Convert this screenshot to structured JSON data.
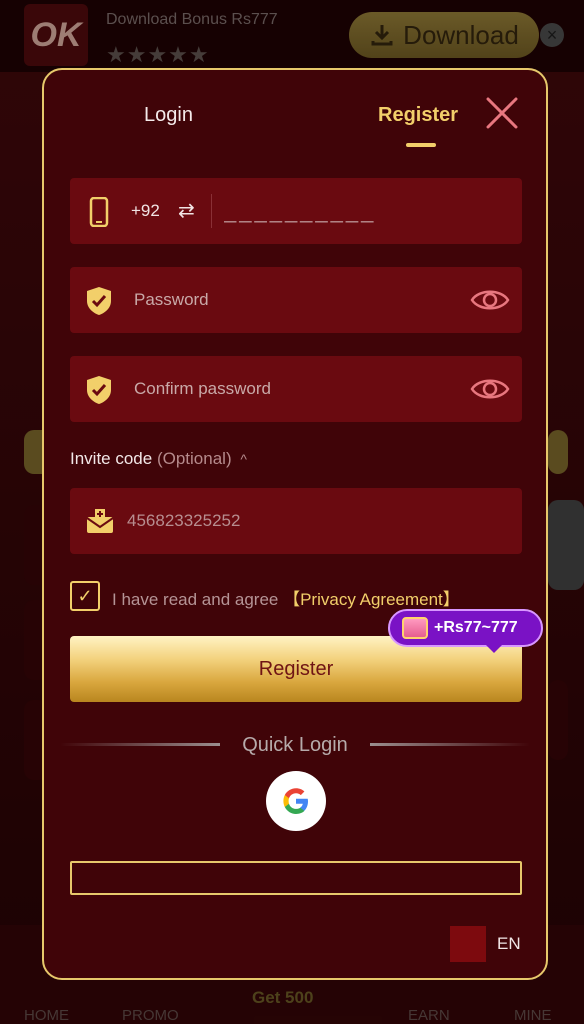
{
  "background": {
    "banner": {
      "logo_text": "OK",
      "title": "Download Bonus Rs777",
      "stars": "★★★★★",
      "download_label": "Download",
      "close_glyph": "×"
    },
    "nav": {
      "home": "HOME",
      "promo": "PROMO",
      "get": "Get 500",
      "earn": "EARN",
      "mine": "MINE"
    }
  },
  "modal": {
    "tabs": {
      "login": "Login",
      "register": "Register"
    },
    "phone": {
      "country_code": "+92",
      "swap_glyph": "⇄",
      "placeholder": "__________"
    },
    "password": {
      "placeholder": "Password"
    },
    "confirm_password": {
      "placeholder": "Confirm password"
    },
    "invite": {
      "label": "Invite code",
      "optional": "(Optional)",
      "caret": "^",
      "value": "456823325252"
    },
    "agreement": {
      "checkbox_glyph": "✓",
      "text": "I have read and agree",
      "link": "【Privacy Agreement】",
      "checked": true
    },
    "register_button": "Register",
    "bonus_badge": "+Rs77~777",
    "quick_login": "Quick Login",
    "language": "EN"
  },
  "colors": {
    "accent_gold": "#f2cf6a",
    "modal_bg": "#400408",
    "field_bg": "#6a0a10"
  }
}
